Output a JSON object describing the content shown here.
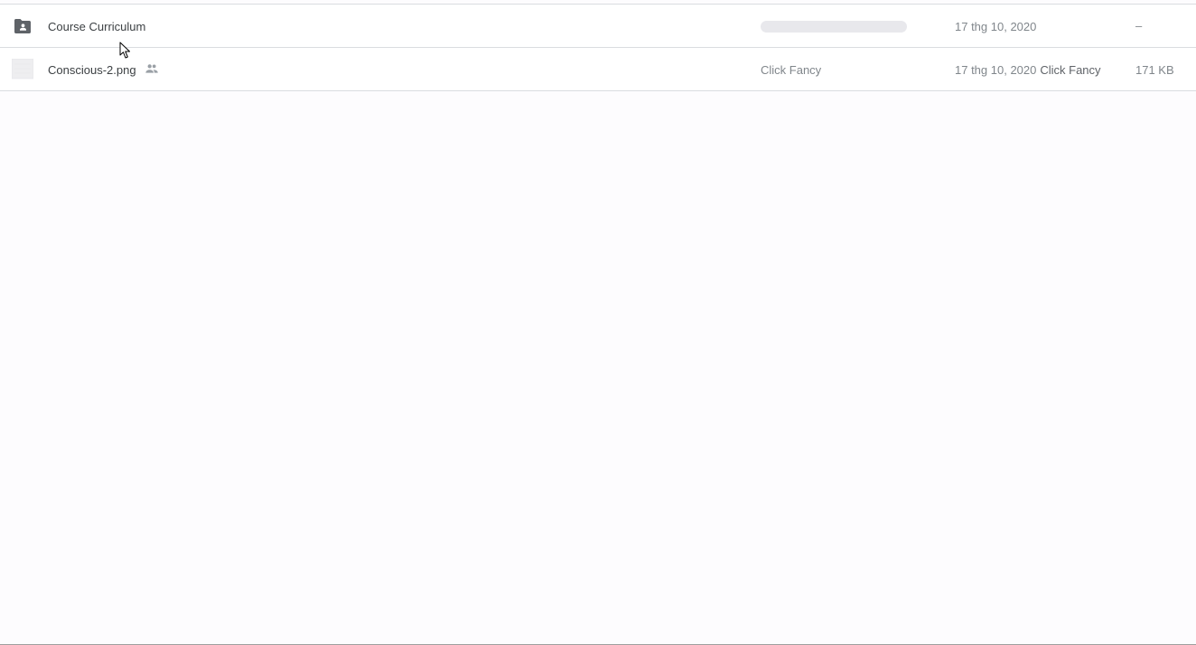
{
  "files": [
    {
      "name": "Course Curriculum",
      "type_icon": "shared-folder-icon",
      "owner": "",
      "modified": "17 thg 10, 2020",
      "modified_by": "",
      "size": "–"
    },
    {
      "name": "Conscious-2.png",
      "type_icon": "image-thumbnail-icon",
      "shared_icon": "people-icon",
      "owner": "Click Fancy",
      "modified": "17 thg 10, 2020",
      "modified_by": "Click Fancy",
      "size": "171 KB"
    }
  ],
  "colors": {
    "background": "#fdfcfe",
    "row_border": "#dadce0",
    "text_primary": "#3c4043",
    "text_secondary": "#80868b",
    "folder_icon": "#5f6368"
  }
}
